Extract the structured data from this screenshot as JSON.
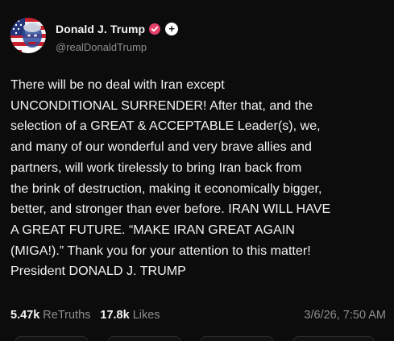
{
  "post": {
    "author": {
      "display_name": "Donald J. Trump",
      "handle": "@realDonaldTrump",
      "verified": true,
      "verified_color": "#e5416a"
    },
    "follow_icon": "plus-icon",
    "body": "There will be no deal with Iran except\nUNCONDITIONAL SURRENDER! After that, and the\nselection of a GREAT & ACCEPTABLE Leader(s), we,\nand many of our wonderful and very brave allies and\npartners, will work tirelessly to bring Iran back from\nthe brink of destruction, making it economically bigger,\nbetter, and stronger than ever before. IRAN WILL HAVE\nA GREAT FUTURE. “MAKE IRAN GREAT AGAIN\n(MIGA!).” Thank you for your attention to this matter!\nPresident DONALD J. TRUMP",
    "stats": {
      "retruths_count": "5.47k",
      "retruths_label": "ReTruths",
      "likes_count": "17.8k",
      "likes_label": "Likes"
    },
    "timestamp": "3/6/26, 7:50 AM"
  },
  "colors": {
    "background": "#0c0c0c",
    "text": "#f2f2f2",
    "muted": "#8e8e93"
  }
}
